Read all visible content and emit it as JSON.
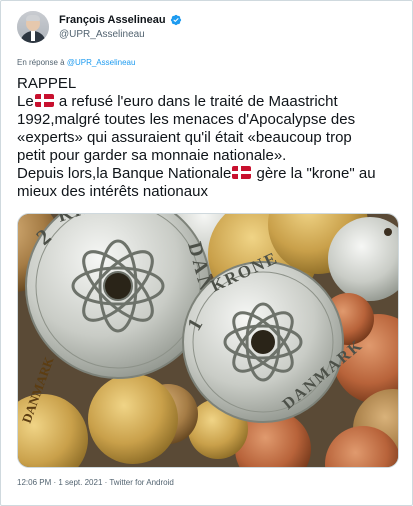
{
  "author": {
    "display_name": "François Asselineau",
    "handle": "@UPR_Asselineau",
    "verified": true
  },
  "reply": {
    "prefix": "En réponse à",
    "mention": "@UPR_Asselineau"
  },
  "tweet": {
    "lines": [
      {
        "before": "RAPPEL",
        "flag": false,
        "after": ""
      },
      {
        "before": "Le",
        "flag": true,
        "after": " a refusé l'euro dans le traité de Maastricht"
      },
      {
        "before": "1992,malgré toutes les menaces d'Apocalypse des",
        "flag": false,
        "after": ""
      },
      {
        "before": "«experts» qui assuraient qu'il était «beaucoup trop",
        "flag": false,
        "after": ""
      },
      {
        "before": "petit pour garder sa monnaie nationale».",
        "flag": false,
        "after": ""
      },
      {
        "before": "Depuis lors,la Banque Nationale",
        "flag": true,
        "after": " gère la \"krone\" au"
      },
      {
        "before": "mieux des intérêts nationaux",
        "flag": false,
        "after": ""
      }
    ]
  },
  "media": {
    "coin_top": [
      "2",
      "KRONE",
      "DANMARK"
    ],
    "coin_bottom": [
      "1",
      "KRONE",
      "DANMARK"
    ],
    "coin_left": "DANMARK"
  },
  "footer": {
    "meta": "12:06 PM · 1 sept. 2021 · Twitter for Android"
  },
  "colors": {
    "accent": "#1d9bf0",
    "flag_red": "#c8102e"
  }
}
